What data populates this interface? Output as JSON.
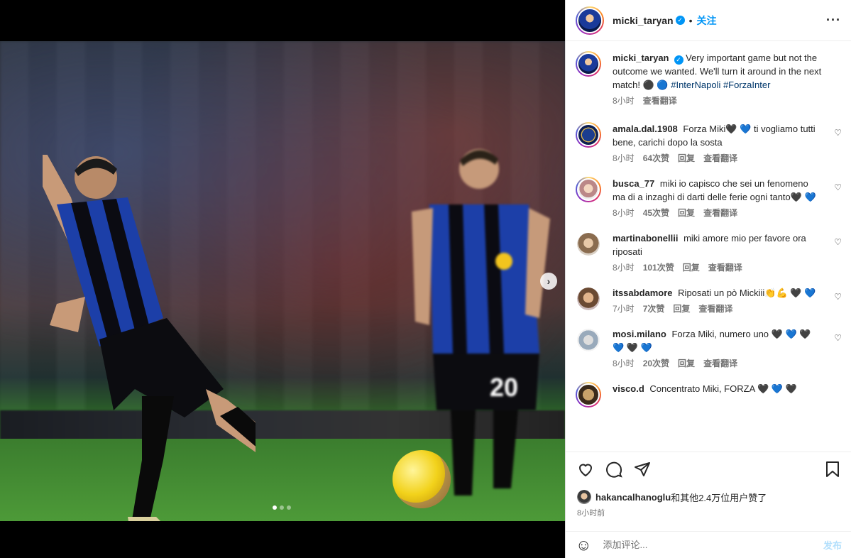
{
  "header": {
    "username": "micki_taryan",
    "separator": "•",
    "follow_label": "关注",
    "more_icon": "more-horizontal-icon"
  },
  "caption": {
    "username": "micki_taryan",
    "text": "Very important game but not the outcome we wanted. We'll turn it around in the next match! ⚫ 🔵 ",
    "hashtags": "#InterNapoli #ForzaInter",
    "time": "8小时",
    "translate": "查看翻译"
  },
  "comments": [
    {
      "username": "amala.dal.1908",
      "text": "Forza Miki🖤 💙 ti vogliamo tutti bene, carichi dopo la sosta",
      "time": "8小时",
      "likes": "64次赞",
      "reply": "回复",
      "translate": "查看翻译"
    },
    {
      "username": "busca_77",
      "text": "miki io capisco che sei un fenomeno ma di a inzaghi di darti delle ferie ogni tanto🖤 💙",
      "time": "8小时",
      "likes": "45次赞",
      "reply": "回复",
      "translate": "查看翻译"
    },
    {
      "username": "martinabonellii",
      "text": "miki amore mio per favore ora riposati",
      "time": "8小时",
      "likes": "101次赞",
      "reply": "回复",
      "translate": "查看翻译"
    },
    {
      "username": "itssabdamore",
      "text": "Riposati un pò Mickiii👏💪 🖤 💙",
      "time": "7小时",
      "likes": "7次赞",
      "reply": "回复",
      "translate": "查看翻译"
    },
    {
      "username": "mosi.milano",
      "text": "Forza Miki, numero uno 🖤 💙 🖤 💙 🖤 💙",
      "time": "8小时",
      "likes": "20次赞",
      "reply": "回复",
      "translate": "查看翻译"
    },
    {
      "username": "visco.d",
      "text": "Concentrato Miki, FORZA 🖤 💙 🖤",
      "time": "",
      "likes": "",
      "reply": "",
      "translate": ""
    }
  ],
  "likes": {
    "user": "hakancalhanoglu",
    "rest": "和其他2.4万位用户赞了"
  },
  "posted_time": "8小时前",
  "composer": {
    "placeholder": "添加评论...",
    "post_label": "发布"
  },
  "carousel": {
    "total": 3,
    "current": 1
  },
  "photo": {
    "jersey_number": "20"
  },
  "colors": {
    "accent": "#0095f6",
    "hashtag": "#00376b",
    "muted": "#737373",
    "post_disabled": "#b2dffc"
  }
}
